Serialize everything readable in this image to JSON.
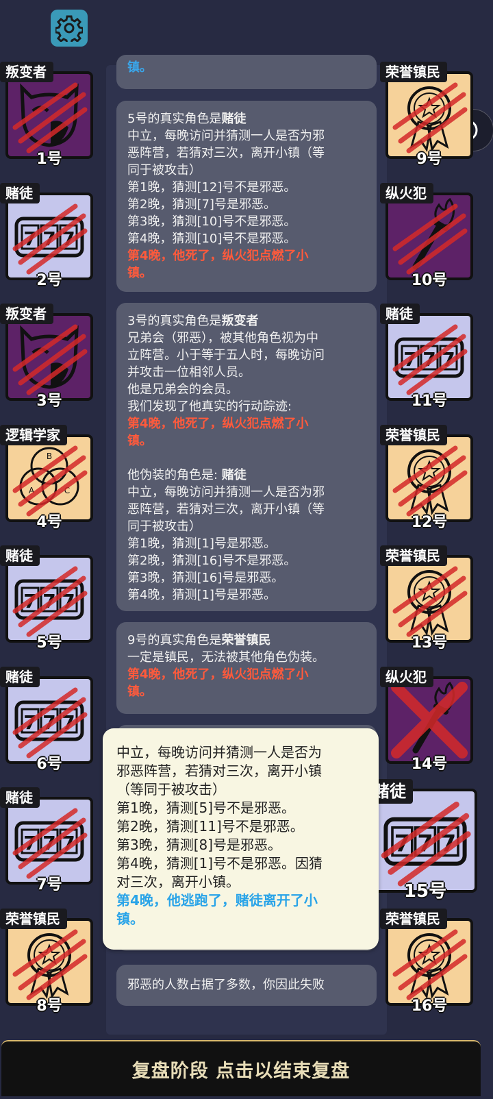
{
  "top_card": {
    "text": "镇。"
  },
  "log_cards": [
    {
      "id": "card5",
      "lines": [
        {
          "prefix": "5号的真实角色是",
          "bold": "赌徒"
        },
        {
          "text": "中立，每晚访问并猜测一人是否为邪"
        },
        {
          "text": "恶阵营，若猜对三次，离开小镇（等"
        },
        {
          "text": "同于被攻击）"
        },
        {
          "text": "第1晚，猜测[12]号不是邪恶。"
        },
        {
          "text": "第2晚，猜测[7]号是邪恶。"
        },
        {
          "text": "第3晚，猜测[10]号不是邪恶。"
        },
        {
          "text": "第4晚，猜测[10]号不是邪恶。"
        },
        {
          "red": "第4晚，他死了，纵火犯点燃了小"
        },
        {
          "red": "镇。"
        }
      ]
    },
    {
      "id": "card3",
      "lines": [
        {
          "prefix": "3号的真实角色是",
          "bold": "叛变者"
        },
        {
          "text": "兄弟会（邪恶），被其他角色视为中"
        },
        {
          "text": "立阵营。小于等于五人时，每晚访问"
        },
        {
          "text": "并攻击一位相邻人员。"
        },
        {
          "text": "他是兄弟会的会员。"
        },
        {
          "text": "我们发现了他真实的行动踪迹:"
        },
        {
          "red": "第4晚，他死了，纵火犯点燃了小"
        },
        {
          "red": "镇。"
        },
        {
          "gap": true
        },
        {
          "prefix": "他伪装的角色是: ",
          "bold": "赌徒"
        },
        {
          "text": "中立，每晚访问并猜测一人是否为邪"
        },
        {
          "text": "恶阵营，若猜对三次，离开小镇（等"
        },
        {
          "text": "同于被攻击）"
        },
        {
          "text": "第1晚，猜测[1]号是邪恶。"
        },
        {
          "text": "第2晚，猜测[16]号不是邪恶。"
        },
        {
          "text": "第3晚，猜测[16]号是邪恶。"
        },
        {
          "text": "第4晚，猜测[1]号是邪恶。"
        }
      ]
    },
    {
      "id": "card9",
      "lines": [
        {
          "prefix": "9号的真实角色是",
          "bold": "荣誉镇民"
        },
        {
          "text": "一定是镇民，无法被其他角色伪装。"
        },
        {
          "red": "第4晚，他死了，纵火犯点燃了小"
        },
        {
          "red": "镇。"
        }
      ]
    }
  ],
  "result_card": {
    "text": "邪恶的人数占据了多数，你因此失败"
  },
  "tooltip": {
    "lines": [
      "中立，每晚访问并猜测一人是否为",
      "邪恶阵营，若猜对三次，离开小镇",
      "（等同于被攻击）",
      "第1晚，猜测[5]号不是邪恶。",
      "第2晚，猜测[11]号不是邪恶。",
      "第3晚，猜测[8]号是邪恶。",
      "第4晚，猜测[1]号不是邪恶。因猜",
      "对三次，离开小镇。"
    ],
    "blue_lines": [
      "第4晚，他逃跑了，赌徒离开了小",
      "镇。"
    ]
  },
  "players_left": [
    {
      "role": "叛变者",
      "num": "1号",
      "icon": "traitor-mask-icon",
      "bg": "purple"
    },
    {
      "role": "赌徒",
      "num": "2号",
      "icon": "slot-777-icon",
      "bg": "lav"
    },
    {
      "role": "叛变者",
      "num": "3号",
      "icon": "traitor-mask-icon",
      "bg": "purple"
    },
    {
      "role": "逻辑学家",
      "num": "4号",
      "icon": "venn-diagram-icon",
      "bg": "peach"
    },
    {
      "role": "赌徒",
      "num": "5号",
      "icon": "slot-777-icon",
      "bg": "lav"
    },
    {
      "role": "赌徒",
      "num": "6号",
      "icon": "slot-777-icon",
      "bg": "lav"
    },
    {
      "role": "赌徒",
      "num": "7号",
      "icon": "slot-777-icon",
      "bg": "lav"
    },
    {
      "role": "荣誉镇民",
      "num": "8号",
      "icon": "medal-icon",
      "bg": "peach"
    }
  ],
  "players_right": [
    {
      "role": "荣誉镇民",
      "num": "9号",
      "icon": "medal-icon",
      "bg": "peach"
    },
    {
      "role": "纵火犯",
      "num": "10号",
      "icon": "torch-icon",
      "bg": "purple"
    },
    {
      "role": "赌徒",
      "num": "11号",
      "icon": "slot-777-icon",
      "bg": "lav"
    },
    {
      "role": "荣誉镇民",
      "num": "12号",
      "icon": "medal-icon",
      "bg": "peach"
    },
    {
      "role": "荣誉镇民",
      "num": "13号",
      "icon": "medal-icon",
      "bg": "peach"
    },
    {
      "role": "纵火犯",
      "num": "14号",
      "icon": "torch-icon",
      "bg": "purple"
    },
    {
      "role": "赌徒",
      "num": "15号",
      "icon": "slot-777-icon",
      "bg": "lav"
    },
    {
      "role": "荣誉镇民",
      "num": "16号",
      "icon": "medal-icon",
      "bg": "peach"
    }
  ],
  "bottom_bar": {
    "label": "复盘阶段 点击以结束复盘"
  },
  "colors": {
    "accent_red": "#ff5a3c",
    "accent_blue": "#3aa6ea",
    "background": "#272a42"
  }
}
